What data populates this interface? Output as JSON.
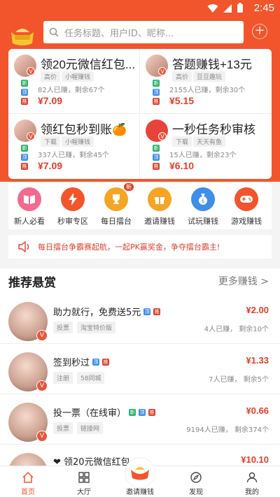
{
  "status_bar": {
    "time": "2:45"
  },
  "header": {
    "search_placeholder": "任务标题、用户ID、昵称..."
  },
  "tasks": [
    {
      "title": "领20元微信红包...",
      "tags": [
        "高价",
        "小喔赚钱"
      ],
      "meta": "82人已赚，剩余67个",
      "price": "¥7.09"
    },
    {
      "title": "答题赚钱+13元",
      "tags": [
        "高价",
        "豆豆趣玩"
      ],
      "meta": "2155人已赚，剩余30个",
      "price": "¥5.15"
    },
    {
      "title": "领红包秒到账🍊",
      "tags": [
        "下载",
        "小喔赚钱"
      ],
      "meta": "337人已赚，剩余45个",
      "price": "¥7.09"
    },
    {
      "title": "一秒任务秒审核",
      "tags": [
        "下载",
        "天天有鱼"
      ],
      "meta": "15人已赚，剩余23个",
      "price": "¥6.10"
    }
  ],
  "menu": [
    {
      "label": "新人必看",
      "icon": "book-icon",
      "color": "#f36a8e"
    },
    {
      "label": "秒审专区",
      "icon": "lightning-icon",
      "color": "#f2552c"
    },
    {
      "label": "每日擂台",
      "icon": "trophy-icon",
      "color": "#f5a524",
      "badge": "新"
    },
    {
      "label": "邀请赚钱",
      "icon": "gift-icon",
      "color": "#f5a524"
    },
    {
      "label": "试玩赚钱",
      "icon": "money-bag-icon",
      "color": "#3f8ee8"
    },
    {
      "label": "游戏赚钱",
      "icon": "gamepad-icon",
      "color": "#f2552c"
    }
  ],
  "notice": {
    "text": "每日擂台争霸赛起航，一起PK赢奖金，争夺擂台霸主!"
  },
  "section": {
    "title": "推荐悬赏",
    "more": "更多赚钱 >"
  },
  "rewards": [
    {
      "name": "助力就行，免费送5元",
      "badges": [
        "blue",
        "red"
      ],
      "tags": [
        "投票",
        "淘宝特价版"
      ],
      "reward": "¥2.00",
      "stat": "4人已赚，  剩余10个"
    },
    {
      "name": "签到秒过",
      "badges": [
        "blue",
        "red"
      ],
      "tags": [
        "注册",
        "58同城"
      ],
      "reward": "¥1.33",
      "stat": "7人已赚，  剩余5个"
    },
    {
      "name": "投一票（在线审）",
      "badges": [
        "green",
        "blue",
        "red"
      ],
      "tags": [
        "投票",
        "链接网"
      ],
      "reward": "¥0.66",
      "stat": "9194人已赚，  剩余374个"
    },
    {
      "name": "❤ 领20元微信红包",
      "badges": [],
      "tags": [],
      "reward": "¥10.10",
      "stat": ""
    }
  ],
  "tabbar": [
    {
      "label": "首页",
      "icon": "home-icon",
      "active": true
    },
    {
      "label": "大厅",
      "icon": "grid-icon",
      "active": false
    },
    {
      "label": "邀请赚钱",
      "icon": "gold-ingot-icon",
      "active": false
    },
    {
      "label": "发现",
      "icon": "compass-icon",
      "active": false
    },
    {
      "label": "我的",
      "icon": "user-icon",
      "active": false
    }
  ],
  "mini_badge_letters": {
    "green": "新",
    "blue": "顶",
    "red": "推"
  }
}
